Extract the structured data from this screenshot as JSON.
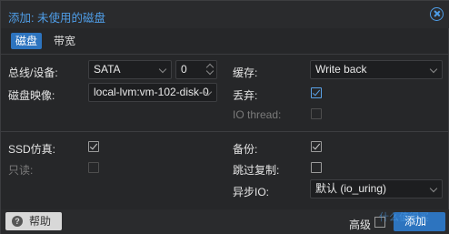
{
  "dialog": {
    "title": "添加: 未使用的磁盘",
    "tabs": [
      {
        "label": "磁盘",
        "active": true
      },
      {
        "label": "带宽",
        "active": false
      }
    ]
  },
  "left": {
    "bus_label": "总线/设备:",
    "bus_value": "SATA",
    "device_value": "0",
    "image_label": "磁盘映像:",
    "image_value": "local-lvm:vm-102-disk-0"
  },
  "right": {
    "cache_label": "缓存:",
    "cache_value": "Write back",
    "discard_label": "丢弃:",
    "discard_checked": true,
    "iothread_label": "IO thread:",
    "iothread_checked": false
  },
  "advanced_left": {
    "ssd_label": "SSD仿真:",
    "ssd_checked": true,
    "readonly_label": "只读:",
    "readonly_checked": false
  },
  "advanced_right": {
    "backup_label": "备份:",
    "backup_checked": true,
    "skip_replication_label": "跳过复制:",
    "skip_replication_checked": false,
    "async_io_label": "异步IO:",
    "async_io_value": "默认 (io_uring)"
  },
  "footer": {
    "help_label": "帮助",
    "advanced_label": "高级",
    "advanced_checked": false,
    "add_label": "添加",
    "watermark": "什么值得买"
  },
  "colors": {
    "accent": "#2d74bf",
    "title": "#4f9ee8",
    "background": "#262729"
  }
}
